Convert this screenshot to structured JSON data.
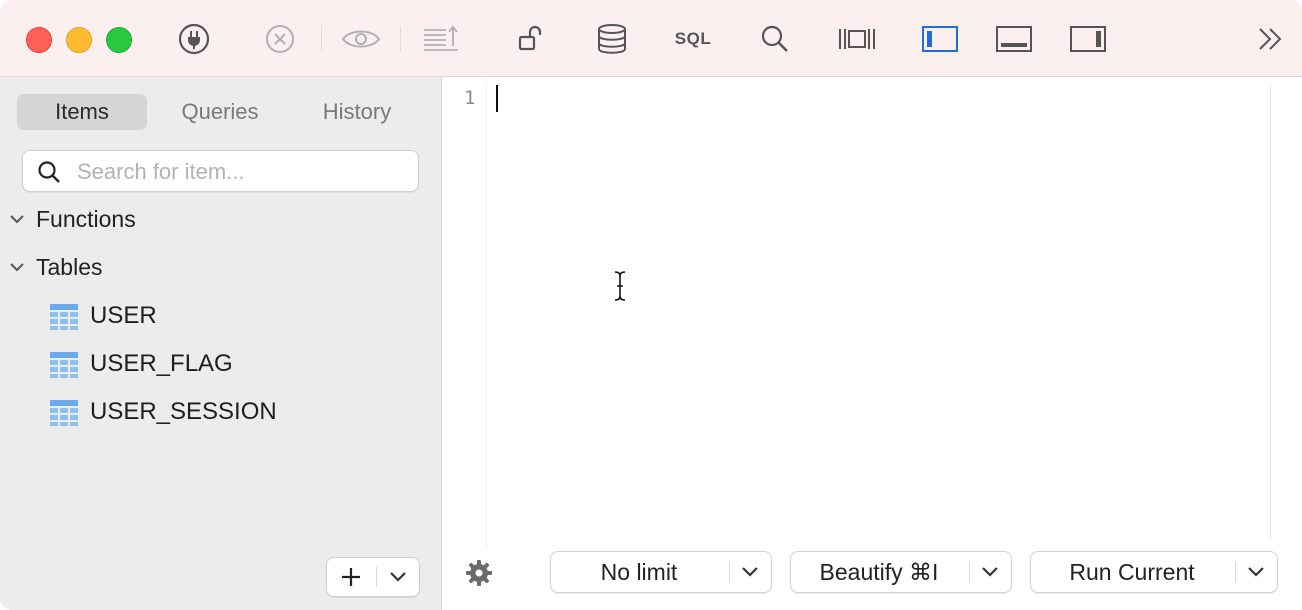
{
  "toolbar": {
    "sql_label": "SQL"
  },
  "sidebar": {
    "tabs": [
      {
        "label": "Items",
        "active": true
      },
      {
        "label": "Queries",
        "active": false
      },
      {
        "label": "History",
        "active": false
      }
    ],
    "search": {
      "placeholder": "Search for item...",
      "value": ""
    },
    "groups": [
      {
        "label": "Functions",
        "expanded": true,
        "items": []
      },
      {
        "label": "Tables",
        "expanded": true,
        "items": [
          "USER",
          "USER_FLAG",
          "USER_SESSION"
        ]
      }
    ]
  },
  "editor": {
    "line_numbers": [
      "1"
    ],
    "content": ""
  },
  "footer": {
    "limit_label": "No limit",
    "beautify_label": "Beautify ⌘I",
    "run_label": "Run Current"
  },
  "colors": {
    "toolbar_bg": "#fbefef",
    "sidebar_bg": "#ececec",
    "table_icon": "#6aa9ec",
    "active_layout": "#1d6fdc"
  }
}
